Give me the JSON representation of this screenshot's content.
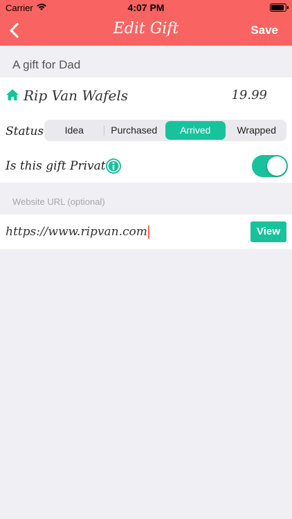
{
  "status_bar": {
    "carrier": "Carrier",
    "time": "4:07 PM"
  },
  "nav": {
    "title": "Edit Gift",
    "save_label": "Save"
  },
  "section_title": "A gift for Dad",
  "gift": {
    "name": "Rip Van Wafels",
    "price": "19.99"
  },
  "status": {
    "label": "Status:",
    "options": [
      "Idea",
      "Purchased",
      "Arrived",
      "Wrapped"
    ],
    "selected": "Arrived"
  },
  "private": {
    "label": "Is this gift Private?",
    "enabled": true
  },
  "url": {
    "header": "Website URL (optional)",
    "value": "https://www.ripvan.com",
    "view_label": "View"
  },
  "colors": {
    "accent_red": "#f96462",
    "accent_green": "#18c29c"
  }
}
